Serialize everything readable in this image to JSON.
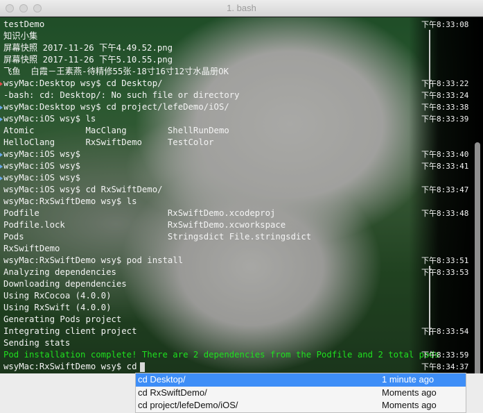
{
  "window": {
    "title": "1. bash"
  },
  "terminal": {
    "lines": [
      {
        "text": "testDemo",
        "time": "下午8:33:08",
        "mark": ""
      },
      {
        "text": "知识小集",
        "time": "",
        "mark": ""
      },
      {
        "text": "屏幕快照 2017-11-26 下午4.49.52.png",
        "time": "",
        "mark": ""
      },
      {
        "text": "屏幕快照 2017-11-26 下午5.10.55.png",
        "time": "",
        "mark": ""
      },
      {
        "text": "飞鱼  白霞－王素燕-待精修55张-18寸16寸12寸水晶册OK",
        "time": "",
        "mark": ""
      },
      {
        "text": "wsyMac:Desktop wsy$ cd Desktop/",
        "time": "下午8:33:22",
        "mark": "red"
      },
      {
        "text": "-bash: cd: Desktop/: No such file or directory",
        "time": "下午8:33:24",
        "mark": ""
      },
      {
        "text": "wsyMac:Desktop wsy$ cd project/lefeDemo/iOS/",
        "time": "下午8:33:38",
        "mark": "blue"
      },
      {
        "text": "wsyMac:iOS wsy$ ls",
        "time": "下午8:33:39",
        "mark": "blue"
      },
      {
        "text": "Atomic          MacClang        ShellRunDemo",
        "time": "",
        "mark": ""
      },
      {
        "text": "HelloClang      RxSwiftDemo     TestColor",
        "time": "",
        "mark": ""
      },
      {
        "text": "wsyMac:iOS wsy$",
        "time": "下午8:33:40",
        "mark": "blue"
      },
      {
        "text": "wsyMac:iOS wsy$",
        "time": "下午8:33:41",
        "mark": "blue"
      },
      {
        "text": "wsyMac:iOS wsy$",
        "time": "",
        "mark": "blue"
      },
      {
        "text": "wsyMac:iOS wsy$ cd RxSwiftDemo/",
        "time": "下午8:33:47",
        "mark": ""
      },
      {
        "text": "wsyMac:RxSwiftDemo wsy$ ls",
        "time": "",
        "mark": ""
      },
      {
        "text": "Podfile                         RxSwiftDemo.xcodeproj",
        "time": "下午8:33:48",
        "mark": ""
      },
      {
        "text": "Podfile.lock                    RxSwiftDemo.xcworkspace",
        "time": "",
        "mark": ""
      },
      {
        "text": "Pods                            Stringsdict File.stringsdict",
        "time": "",
        "mark": ""
      },
      {
        "text": "RxSwiftDemo",
        "time": "",
        "mark": ""
      },
      {
        "text": "wsyMac:RxSwiftDemo wsy$ pod install",
        "time": "下午8:33:51",
        "mark": ""
      },
      {
        "text": "Analyzing dependencies",
        "time": "下午8:33:53",
        "mark": ""
      },
      {
        "text": "Downloading dependencies",
        "time": "",
        "mark": ""
      },
      {
        "text": "Using RxCocoa (4.0.0)",
        "time": "",
        "mark": ""
      },
      {
        "text": "Using RxSwift (4.0.0)",
        "time": "",
        "mark": ""
      },
      {
        "text": "Generating Pods project",
        "time": "",
        "mark": ""
      },
      {
        "text": "Integrating client project",
        "time": "下午8:33:54",
        "mark": ""
      },
      {
        "text": "Sending stats",
        "time": "",
        "mark": ""
      },
      {
        "text": "Pod installation complete! There are 2 dependencies from the Podfile and 2 total pods",
        "time": "下午8:33:59",
        "mark": "",
        "color": "green"
      },
      {
        "text": "wsyMac:RxSwiftDemo wsy$ cd",
        "time": "下午8:34:37",
        "mark": "",
        "cursor": true
      }
    ]
  },
  "history_popup": {
    "items": [
      {
        "command": "cd Desktop/",
        "when": "1 minute ago",
        "selected": true
      },
      {
        "command": "cd RxSwiftDemo/",
        "when": "Moments ago",
        "selected": false
      },
      {
        "command": "cd project/lefeDemo/iOS/",
        "when": "Moments ago",
        "selected": false
      }
    ]
  },
  "colors": {
    "selection": "#3e8ef7",
    "success_text": "#1fe01f",
    "mark_blue": "#6aa9e8",
    "mark_red": "#e04b4b"
  }
}
